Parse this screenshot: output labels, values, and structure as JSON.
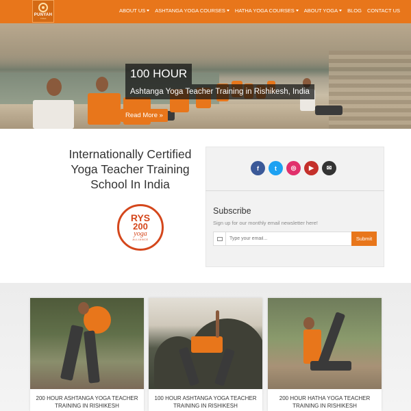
{
  "brand": {
    "logo_text": "PUNYAH",
    "logo_sub": "YOGA"
  },
  "nav": {
    "items": [
      {
        "label": "ABOUT US",
        "dropdown": true
      },
      {
        "label": "ASHTANGA YOGA COURSES",
        "dropdown": true
      },
      {
        "label": "HATHA YOGA COURSES",
        "dropdown": true
      },
      {
        "label": "ABOUT YOGA",
        "dropdown": true
      },
      {
        "label": "BLOG",
        "dropdown": false
      },
      {
        "label": "CONTACT US",
        "dropdown": false
      }
    ]
  },
  "hero": {
    "title": "100 HOUR",
    "subtitle": "Ashtanga Yoga Teacher Training in Rishikesh, India",
    "cta": "Read More »"
  },
  "info": {
    "heading_lines": [
      "Internationally Certified",
      "Yoga Teacher Training",
      "School In India"
    ],
    "badge": {
      "line1": "RYS",
      "line2": "200",
      "line3": "yoga",
      "line4": "ALLIANCE"
    }
  },
  "social": [
    {
      "name": "facebook-icon",
      "glyph": "f",
      "color": "#3b5998"
    },
    {
      "name": "twitter-icon",
      "glyph": "t",
      "color": "#1da1f2"
    },
    {
      "name": "instagram-icon",
      "glyph": "◎",
      "color": "#e1306c"
    },
    {
      "name": "youtube-icon",
      "glyph": "▶",
      "color": "#c4302b"
    },
    {
      "name": "email-icon",
      "glyph": "✉",
      "color": "#333333"
    }
  ],
  "subscribe": {
    "title": "Subscribe",
    "text": "Sign up for our monthly email newsletter here!",
    "placeholder": "Type your email...",
    "button": "Submit"
  },
  "cards": [
    {
      "title": "200 HOUR ASHTANGA YOGA TEACHER TRAINING IN RISHIKESH"
    },
    {
      "title": "100 HOUR ASHTANGA YOGA TEACHER TRAINING IN RISHIKESH"
    },
    {
      "title": "200 HOUR HATHA YOGA TEACHER TRAINING IN RISHIKESH"
    }
  ],
  "colors": {
    "accent": "#e8761b",
    "badge": "#d4471c"
  }
}
